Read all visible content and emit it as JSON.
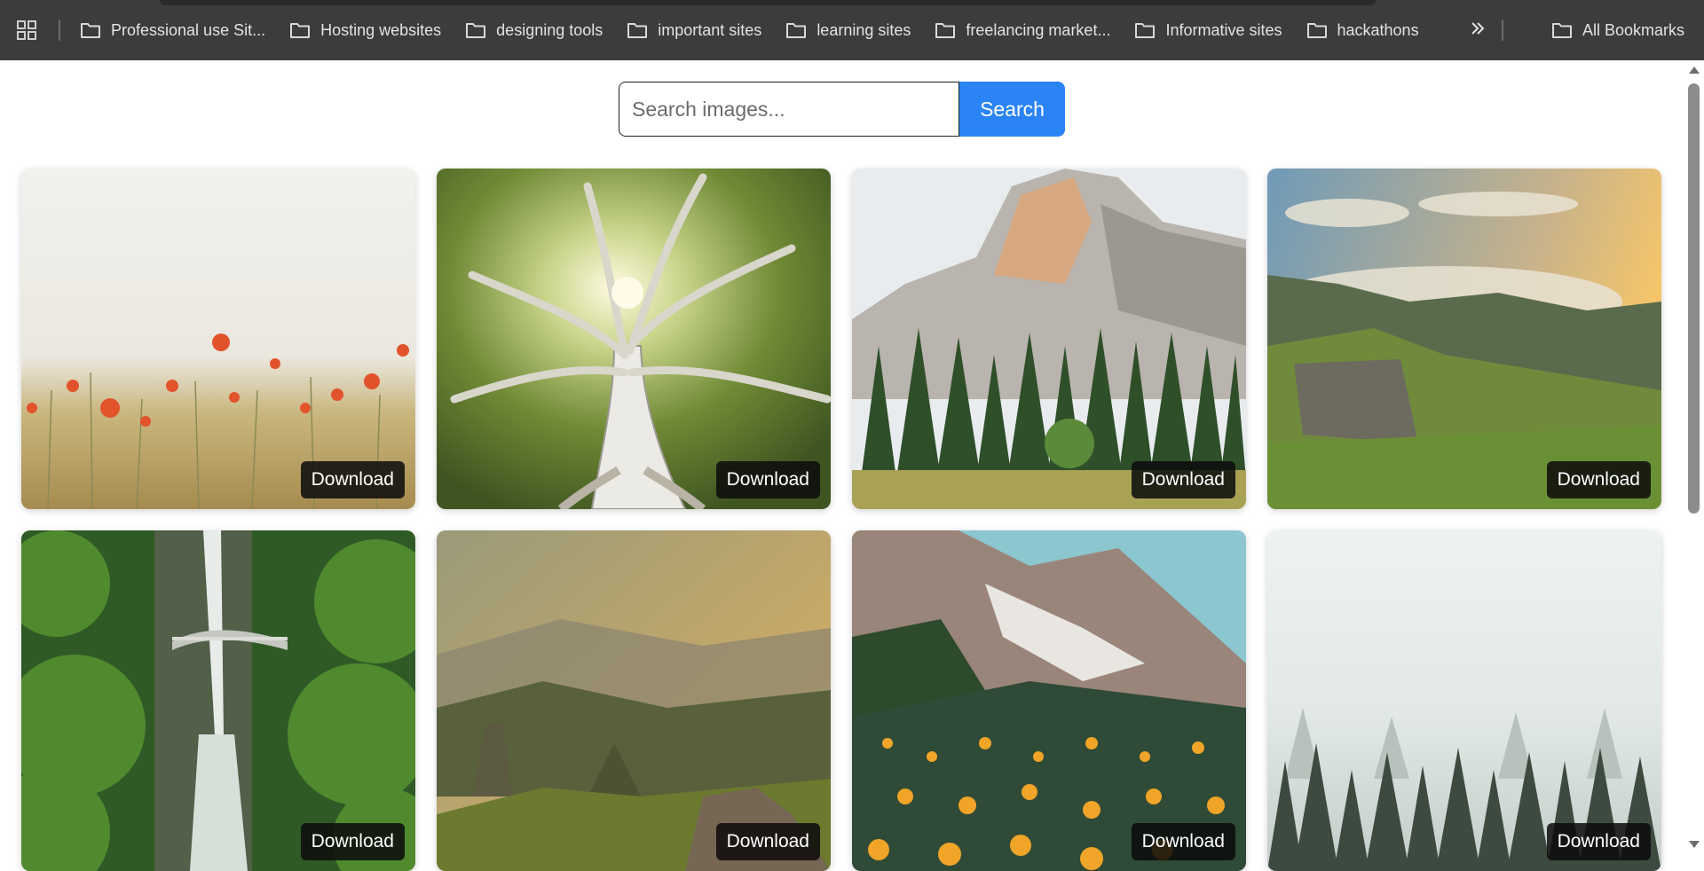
{
  "bookmarks_bar": {
    "apps_icon": "apps-grid-icon",
    "folders": [
      {
        "label": "Professional use Sit..."
      },
      {
        "label": "Hosting websites"
      },
      {
        "label": "designing tools"
      },
      {
        "label": "important sites"
      },
      {
        "label": "learning sites"
      },
      {
        "label": "freelancing market..."
      },
      {
        "label": "Informative sites"
      },
      {
        "label": "hackathons"
      }
    ],
    "overflow_icon": "double-chevron-right-icon",
    "all_bookmarks_label": "All Bookmarks"
  },
  "search": {
    "placeholder": "Search images...",
    "value": "",
    "button_label": "Search"
  },
  "gallery": {
    "download_label": "Download",
    "images": [
      {
        "subject": "poppy-field"
      },
      {
        "subject": "large-tree"
      },
      {
        "subject": "granite-mountain-forest"
      },
      {
        "subject": "misty-green-valley"
      },
      {
        "subject": "waterfall-bridge"
      },
      {
        "subject": "golden-hills-rocks"
      },
      {
        "subject": "alpine-flower-meadow"
      },
      {
        "subject": "foggy-pine-forest"
      }
    ]
  },
  "colors": {
    "bookmarks_bg": "#3c3c3c",
    "search_button": "#2a84f5",
    "download_bg": "#0c0c0c"
  }
}
